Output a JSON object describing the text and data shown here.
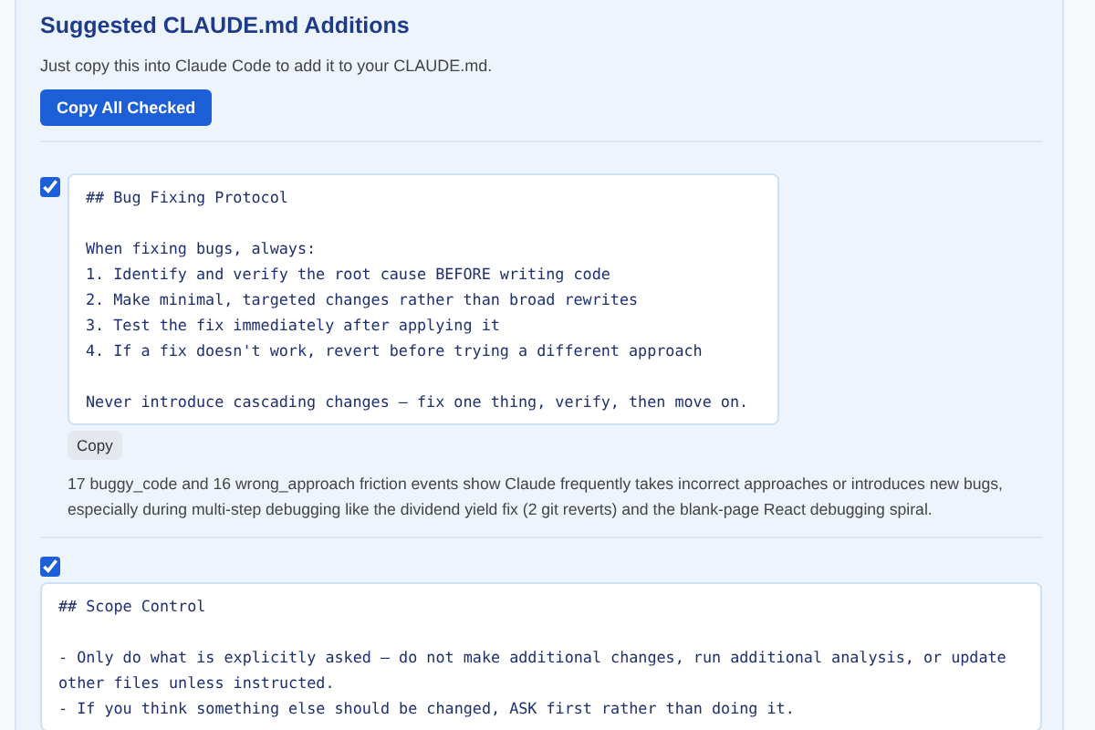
{
  "section": {
    "title": "Suggested CLAUDE.md Additions",
    "description": "Just copy this into Claude Code to add it to your CLAUDE.md.",
    "copy_all_button": "Copy All Checked"
  },
  "suggestions": [
    {
      "kind": "inline",
      "checked": true,
      "paragraphs": [
        [
          "## Bug Fixing Protocol"
        ],
        [
          "When fixing bugs, always:",
          "1. Identify and verify the root cause BEFORE writing code",
          "2. Make minimal, targeted changes rather than broad rewrites",
          "3. Test the fix immediately after applying it",
          "4. If a fix doesn't work, revert before trying a different approach"
        ],
        [
          "Never introduce cascading changes — fix one thing, verify, then move on."
        ]
      ],
      "copy_button": "Copy",
      "rationale": "17 buggy_code and 16 wrong_approach friction events show Claude frequently takes incorrect approaches or introduces new bugs, especially during multi-step debugging like the dividend yield fix (2 git reverts) and the blank-page React debugging spiral."
    },
    {
      "kind": "stacked",
      "checked": true,
      "paragraphs": [
        [
          "## Scope Control"
        ],
        [
          "- Only do what is explicitly asked — do not make additional changes, run additional analysis, or update other files unless instructed.",
          "- If you think something else should be changed, ASK first rather than doing it."
        ]
      ]
    }
  ]
}
